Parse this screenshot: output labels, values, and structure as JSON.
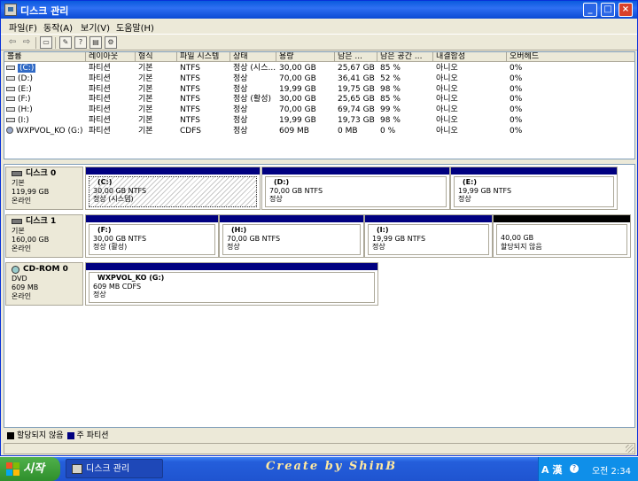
{
  "window": {
    "title": "디스크 관리"
  },
  "menu": [
    "파일(F)",
    "동작(A)",
    "보기(V)",
    "도움말(H)"
  ],
  "toolbar": {
    "icons": [
      "back-arrow-icon",
      "forward-arrow-icon",
      "console-tree-icon",
      "properties-icon",
      "help-icon",
      "export-icon"
    ]
  },
  "columns": [
    "볼륨",
    "레이아웃",
    "형식",
    "파일 시스템",
    "상태",
    "용량",
    "남은 ...",
    "남은 공간 ...",
    "내결함성",
    "오버헤드"
  ],
  "volumes": [
    {
      "name": "(C:)",
      "selected": true,
      "layout": "파티션",
      "type": "기본",
      "fs": "NTFS",
      "status": "정상 (시스...",
      "capacity": "30,00 GB",
      "free": "25,67 GB",
      "pct": "85 %",
      "fault": "아니오",
      "overhead": "0%"
    },
    {
      "name": "(D:)",
      "layout": "파티션",
      "type": "기본",
      "fs": "NTFS",
      "status": "정상",
      "capacity": "70,00 GB",
      "free": "36,41 GB",
      "pct": "52 %",
      "fault": "아니오",
      "overhead": "0%"
    },
    {
      "name": "(E:)",
      "layout": "파티션",
      "type": "기본",
      "fs": "NTFS",
      "status": "정상",
      "capacity": "19,99 GB",
      "free": "19,75 GB",
      "pct": "98 %",
      "fault": "아니오",
      "overhead": "0%"
    },
    {
      "name": "(F:)",
      "layout": "파티션",
      "type": "기본",
      "fs": "NTFS",
      "status": "정상 (활성)",
      "capacity": "30,00 GB",
      "free": "25,65 GB",
      "pct": "85 %",
      "fault": "아니오",
      "overhead": "0%"
    },
    {
      "name": "(H:)",
      "layout": "파티션",
      "type": "기본",
      "fs": "NTFS",
      "status": "정상",
      "capacity": "70,00 GB",
      "free": "69,74 GB",
      "pct": "99 %",
      "fault": "아니오",
      "overhead": "0%"
    },
    {
      "name": "(I:)",
      "layout": "파티션",
      "type": "기본",
      "fs": "NTFS",
      "status": "정상",
      "capacity": "19,99 GB",
      "free": "19,73 GB",
      "pct": "98 %",
      "fault": "아니오",
      "overhead": "0%"
    },
    {
      "name": "WXPVOL_KO (G:)",
      "cd": true,
      "layout": "파티션",
      "type": "기본",
      "fs": "CDFS",
      "status": "정상",
      "capacity": "609 MB",
      "free": "0 MB",
      "pct": "0 %",
      "fault": "아니오",
      "overhead": "0%"
    }
  ],
  "disks": [
    {
      "title": "디스크 0",
      "kind": "기본",
      "size": "119,99 GB",
      "state": "온라인",
      "partitions": [
        {
          "name": "(C:)",
          "size": "30,00 GB NTFS",
          "status": "정상 (시스템)",
          "hatched": true
        },
        {
          "name": "(D:)",
          "size": "70,00 GB NTFS",
          "status": "정상"
        },
        {
          "name": "(E:)",
          "size": "19,99 GB NTFS",
          "status": "정상"
        }
      ]
    },
    {
      "title": "디스크 1",
      "kind": "기본",
      "size": "160,00 GB",
      "state": "온라인",
      "partitions": [
        {
          "name": "(F:)",
          "size": "30,00 GB NTFS",
          "status": "정상 (활성)"
        },
        {
          "name": "(H:)",
          "size": "70,00 GB NTFS",
          "status": "정상"
        },
        {
          "name": "(I:)",
          "size": "19,99 GB NTFS",
          "status": "정상"
        },
        {
          "name": "",
          "size": "40,00 GB",
          "status": "할당되지 않음",
          "unallocated": true
        }
      ]
    },
    {
      "title": "CD-ROM 0",
      "kind": "DVD",
      "size": "609 MB",
      "state": "온라인",
      "partitions": [
        {
          "name": "WXPVOL_KO  (G:)",
          "size": "609 MB CDFS",
          "status": "정상"
        }
      ]
    }
  ],
  "legend": [
    {
      "label": "할당되지 않음",
      "color": "#000000"
    },
    {
      "label": "주 파티션",
      "color": "#000080"
    }
  ],
  "taskbar": {
    "start": "시작",
    "task": "디스크 관리",
    "watermark": "Create by ShinB",
    "ime": "A 漢",
    "clock": "오전 2:34"
  }
}
